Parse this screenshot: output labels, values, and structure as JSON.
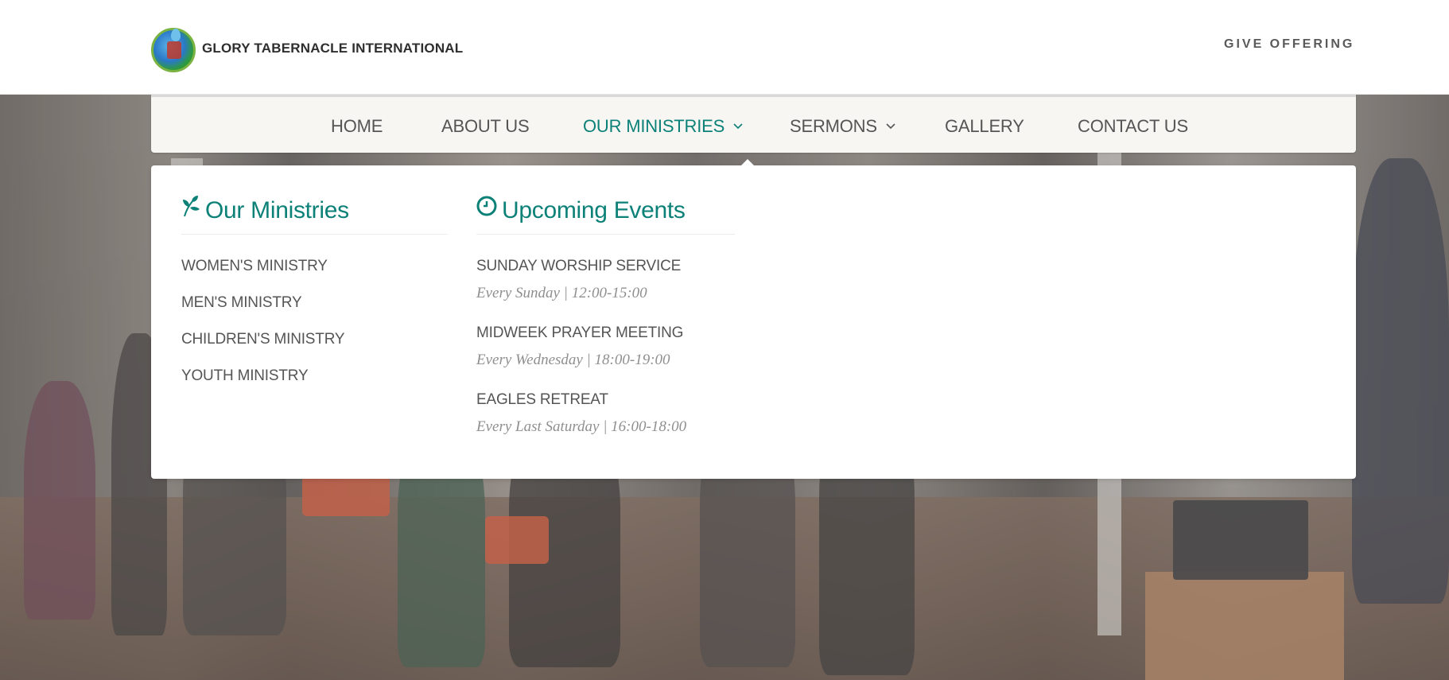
{
  "header": {
    "logo_text": "GLORY TABERNACLE INTERNATIONAL",
    "give_offering": "GIVE OFFERING"
  },
  "nav": {
    "items": [
      {
        "label": "HOME"
      },
      {
        "label": "ABOUT US"
      },
      {
        "label": "OUR MINISTRIES",
        "has_dropdown": true,
        "active": true
      },
      {
        "label": "SERMONS",
        "has_dropdown": true
      },
      {
        "label": "GALLERY"
      },
      {
        "label": "CONTACT US"
      }
    ],
    "chevron_glyph": "⌄"
  },
  "dropdown": {
    "ministries": {
      "title": "Our Ministries",
      "icon": "leaf-icon",
      "items": [
        "WOMEN'S MINISTRY",
        "MEN'S MINISTRY",
        "CHILDREN'S MINISTRY",
        "YOUTH MINISTRY"
      ]
    },
    "events": {
      "title": "Upcoming Events",
      "icon": "clock-icon",
      "items": [
        {
          "title": "SUNDAY WORSHIP SERVICE",
          "time": "Every Sunday | 12:00-15:00"
        },
        {
          "title": "MIDWEEK PRAYER MEETING",
          "time": "Every Wednesday | 18:00-19:00"
        },
        {
          "title": "EAGLES RETREAT",
          "time": "Every Last Saturday | 16:00-18:00"
        }
      ]
    }
  },
  "colors": {
    "accent": "#0c8178",
    "nav_bg": "#f7f6f3",
    "text": "#555555",
    "muted": "#8f8f8f"
  }
}
